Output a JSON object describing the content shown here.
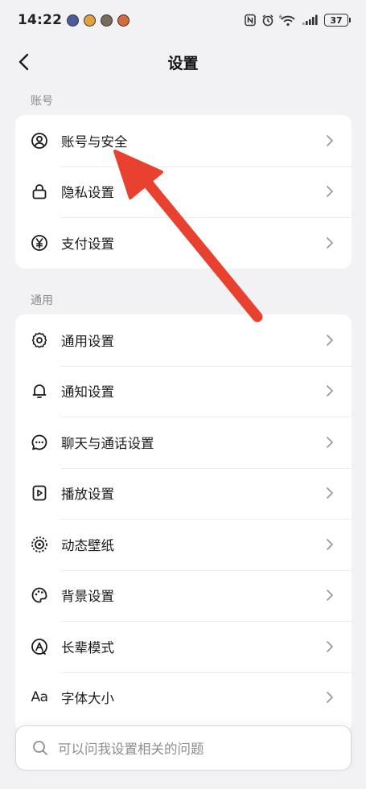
{
  "status": {
    "time": "14:22",
    "battery": "37"
  },
  "nav": {
    "title": "设置"
  },
  "sections": {
    "account": {
      "label": "账号",
      "items": [
        {
          "label": "账号与安全",
          "icon": "user-circle-icon"
        },
        {
          "label": "隐私设置",
          "icon": "lock-icon"
        },
        {
          "label": "支付设置",
          "icon": "yuan-icon"
        }
      ]
    },
    "general": {
      "label": "通用",
      "items": [
        {
          "label": "通用设置",
          "icon": "gear-icon"
        },
        {
          "label": "通知设置",
          "icon": "bell-icon"
        },
        {
          "label": "聊天与通话设置",
          "icon": "chat-bubble-icon"
        },
        {
          "label": "播放设置",
          "icon": "play-frame-icon"
        },
        {
          "label": "动态壁纸",
          "icon": "live-wallpaper-icon"
        },
        {
          "label": "背景设置",
          "icon": "palette-icon"
        },
        {
          "label": "长辈模式",
          "icon": "elder-mode-icon"
        },
        {
          "label": "字体大小",
          "icon": "font-size-icon",
          "glyph": "Aa"
        }
      ]
    }
  },
  "search": {
    "placeholder": "可以问我设置相关的问题"
  },
  "colors": {
    "annotation_arrow": "#e8412f",
    "background": "#f2f2f4",
    "card": "#ffffff"
  }
}
